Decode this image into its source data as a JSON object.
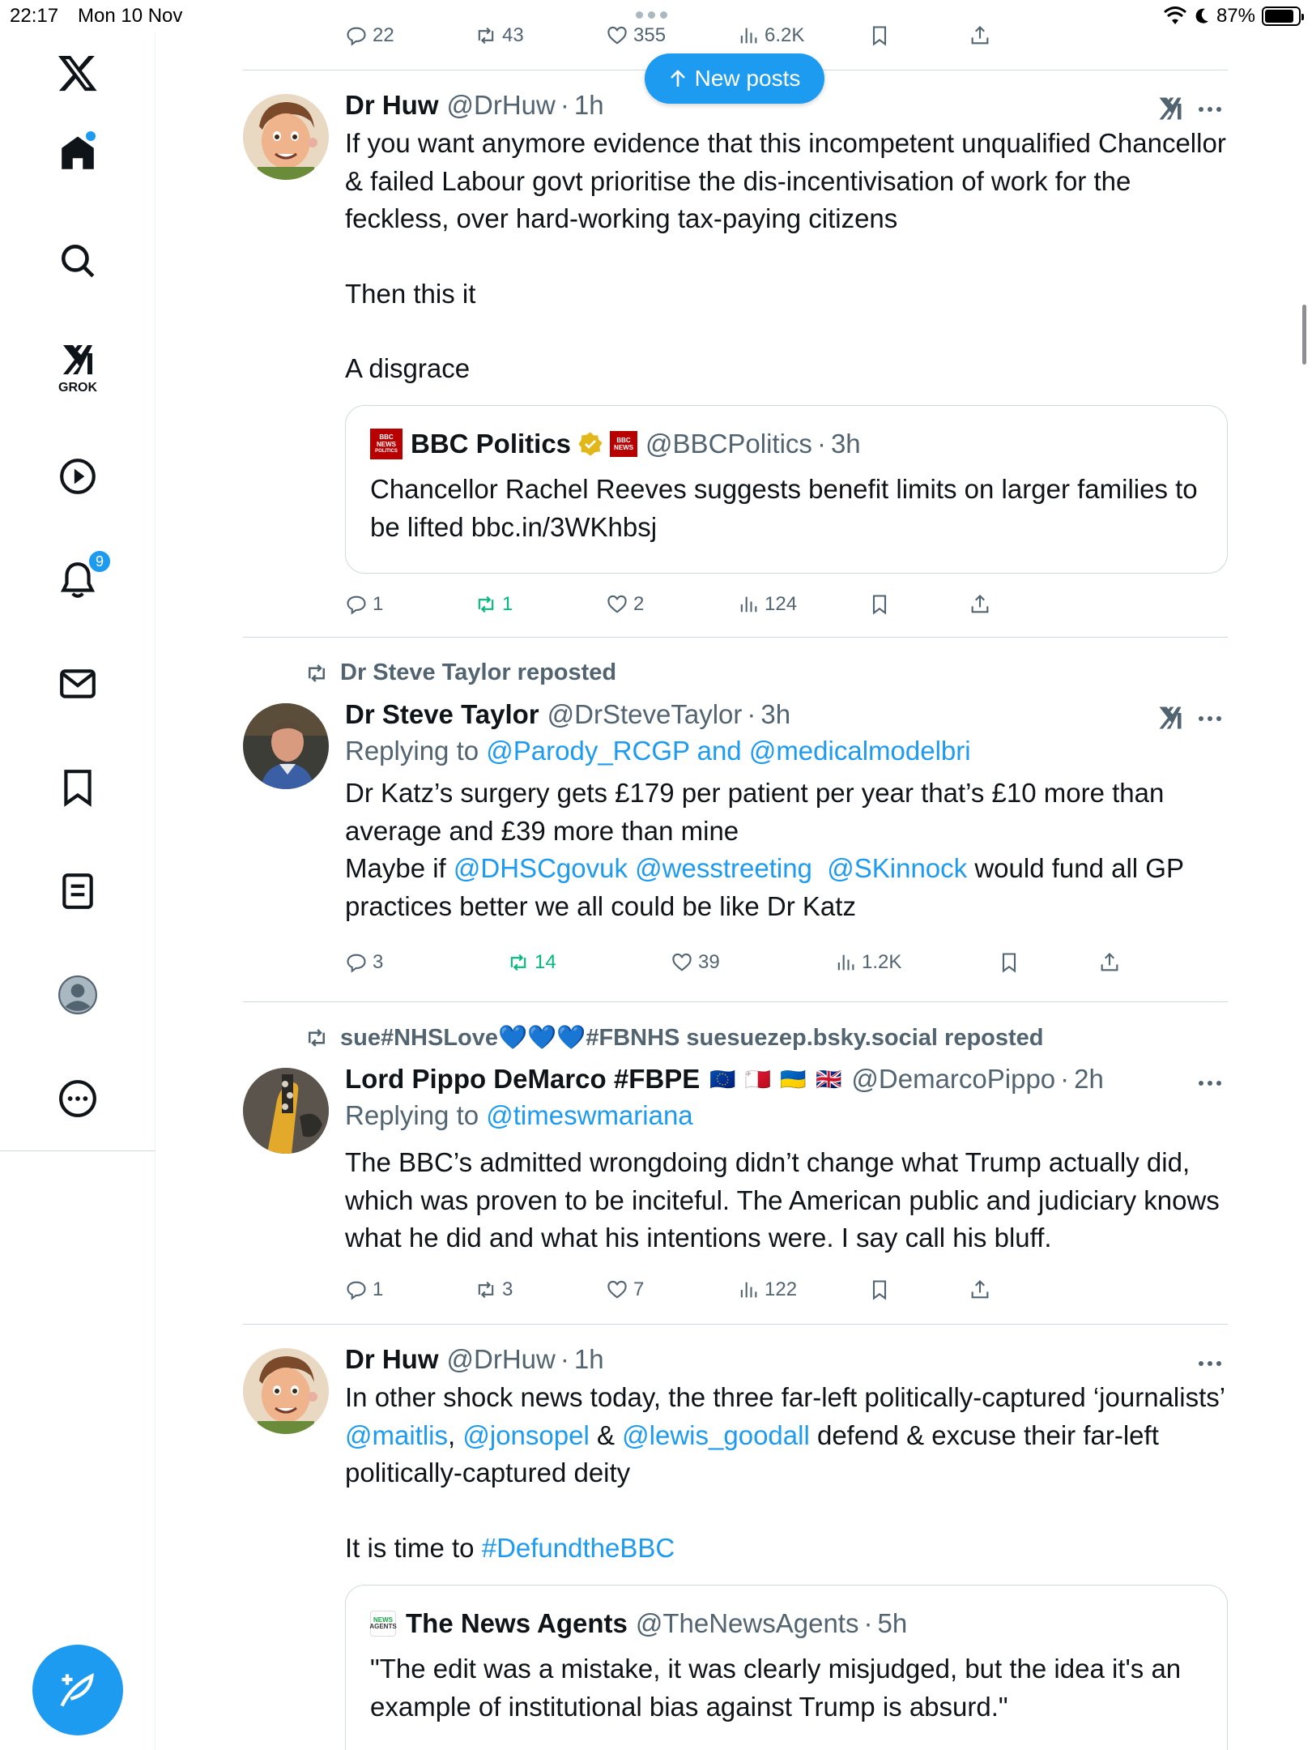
{
  "status_bar": {
    "time": "22:17",
    "date": "Mon 10 Nov",
    "battery": "87%"
  },
  "sidebar": {
    "grok_label": "GROK",
    "notifications_badge": "9",
    "items": [
      "x-logo",
      "home",
      "search",
      "grok",
      "video",
      "notifications",
      "messages",
      "bookmarks",
      "lists",
      "profile",
      "more"
    ]
  },
  "new_posts_label": "New posts",
  "top_actions": {
    "replies": "22",
    "reposts": "43",
    "likes": "355",
    "views": "6.2K"
  },
  "posts": [
    {
      "name": "Dr Huw",
      "handle": "@DrHuw",
      "time": "1h",
      "text1": "If you want anymore evidence that this incompetent unqualified Chancellor & failed Labour govt prioritise the dis-incentivisation of work for the feckless, over hard-working tax-paying citizens",
      "text2": "Then this it",
      "text3": "A disgrace",
      "quote": {
        "name": "BBC Politics",
        "handle": "@BBCPolitics",
        "time": "3h",
        "logo_text_1": "BBC",
        "logo_text_2": "NEWS",
        "logo_text_3": "POLITICS",
        "text": "Chancellor Rachel Reeves suggests benefit limits on larger families to be lifted bbc.in/3WKhbsj"
      },
      "actions": {
        "replies": "1",
        "reposts": "1",
        "likes": "2",
        "views": "124"
      }
    },
    {
      "repost_by": "Dr Steve Taylor reposted",
      "name": "Dr Steve Taylor",
      "handle": "@DrSteveTaylor",
      "time": "3h",
      "replying_prefix": "Replying to ",
      "replying_to": "@Parody_RCGP and @medicalmodelbri",
      "line1": "Dr Katz’s surgery gets £179 per patient per year that’s £10 more than average and £39 more than mine",
      "line2_prefix": "Maybe if ",
      "mention1": "@DHSCgovuk",
      "mention2": "@wesstreeting",
      "mention3": "@SKinnock",
      "line2_suffix": " would fund all GP practices better we all could be like Dr Katz",
      "actions": {
        "replies": "3",
        "reposts": "14",
        "likes": "39",
        "views": "1.2K"
      }
    },
    {
      "repost_by": "sue#NHSLove💙💙💙#FBNHS suesuezep.bsky.social reposted",
      "name": "Lord Pippo DeMarco #FBPE",
      "flags": "🇪🇺 🇲🇹 🇺🇦 🇬🇧",
      "handle": "@DemarcoPippo",
      "time": "2h",
      "replying_prefix": "Replying to ",
      "replying_to": "@timeswmariana",
      "text": "The BBC’s admitted wrongdoing didn’t change what Trump actually did, which was proven to be inciteful. The American public and judiciary knows what he did and what his intentions were.  I say call his bluff.",
      "actions": {
        "replies": "1",
        "reposts": "3",
        "likes": "7",
        "views": "122"
      }
    },
    {
      "name": "Dr Huw",
      "handle": "@DrHuw",
      "time": "1h",
      "text_prefix": "In other shock news today, the three far-left politically-captured ‘journalists’ ",
      "mention1": "@maitlis",
      "comma": ", ",
      "mention2": "@jonsopel",
      "amp": " & ",
      "mention3": "@lewis_goodall",
      "text_suffix": " defend & excuse their far-left politically-captured deity",
      "text2_prefix": "It is time to ",
      "hashtag": "#DefundtheBBC",
      "quote": {
        "name": "The News Agents",
        "handle": "@TheNewsAgents",
        "time": "5h",
        "logo_text_1": "NEWS",
        "logo_text_2": "AGENTS",
        "text": "\"The edit was a mistake, it was clearly misjudged, but the idea it's an example of institutional bias against Trump is absurd.\""
      }
    }
  ],
  "colors": {
    "accent": "#1d9bf0",
    "repost_green": "#00ba7c",
    "secondary_text": "#536471",
    "verified_gold": "#e2b719",
    "bbc_red": "#b80000"
  }
}
